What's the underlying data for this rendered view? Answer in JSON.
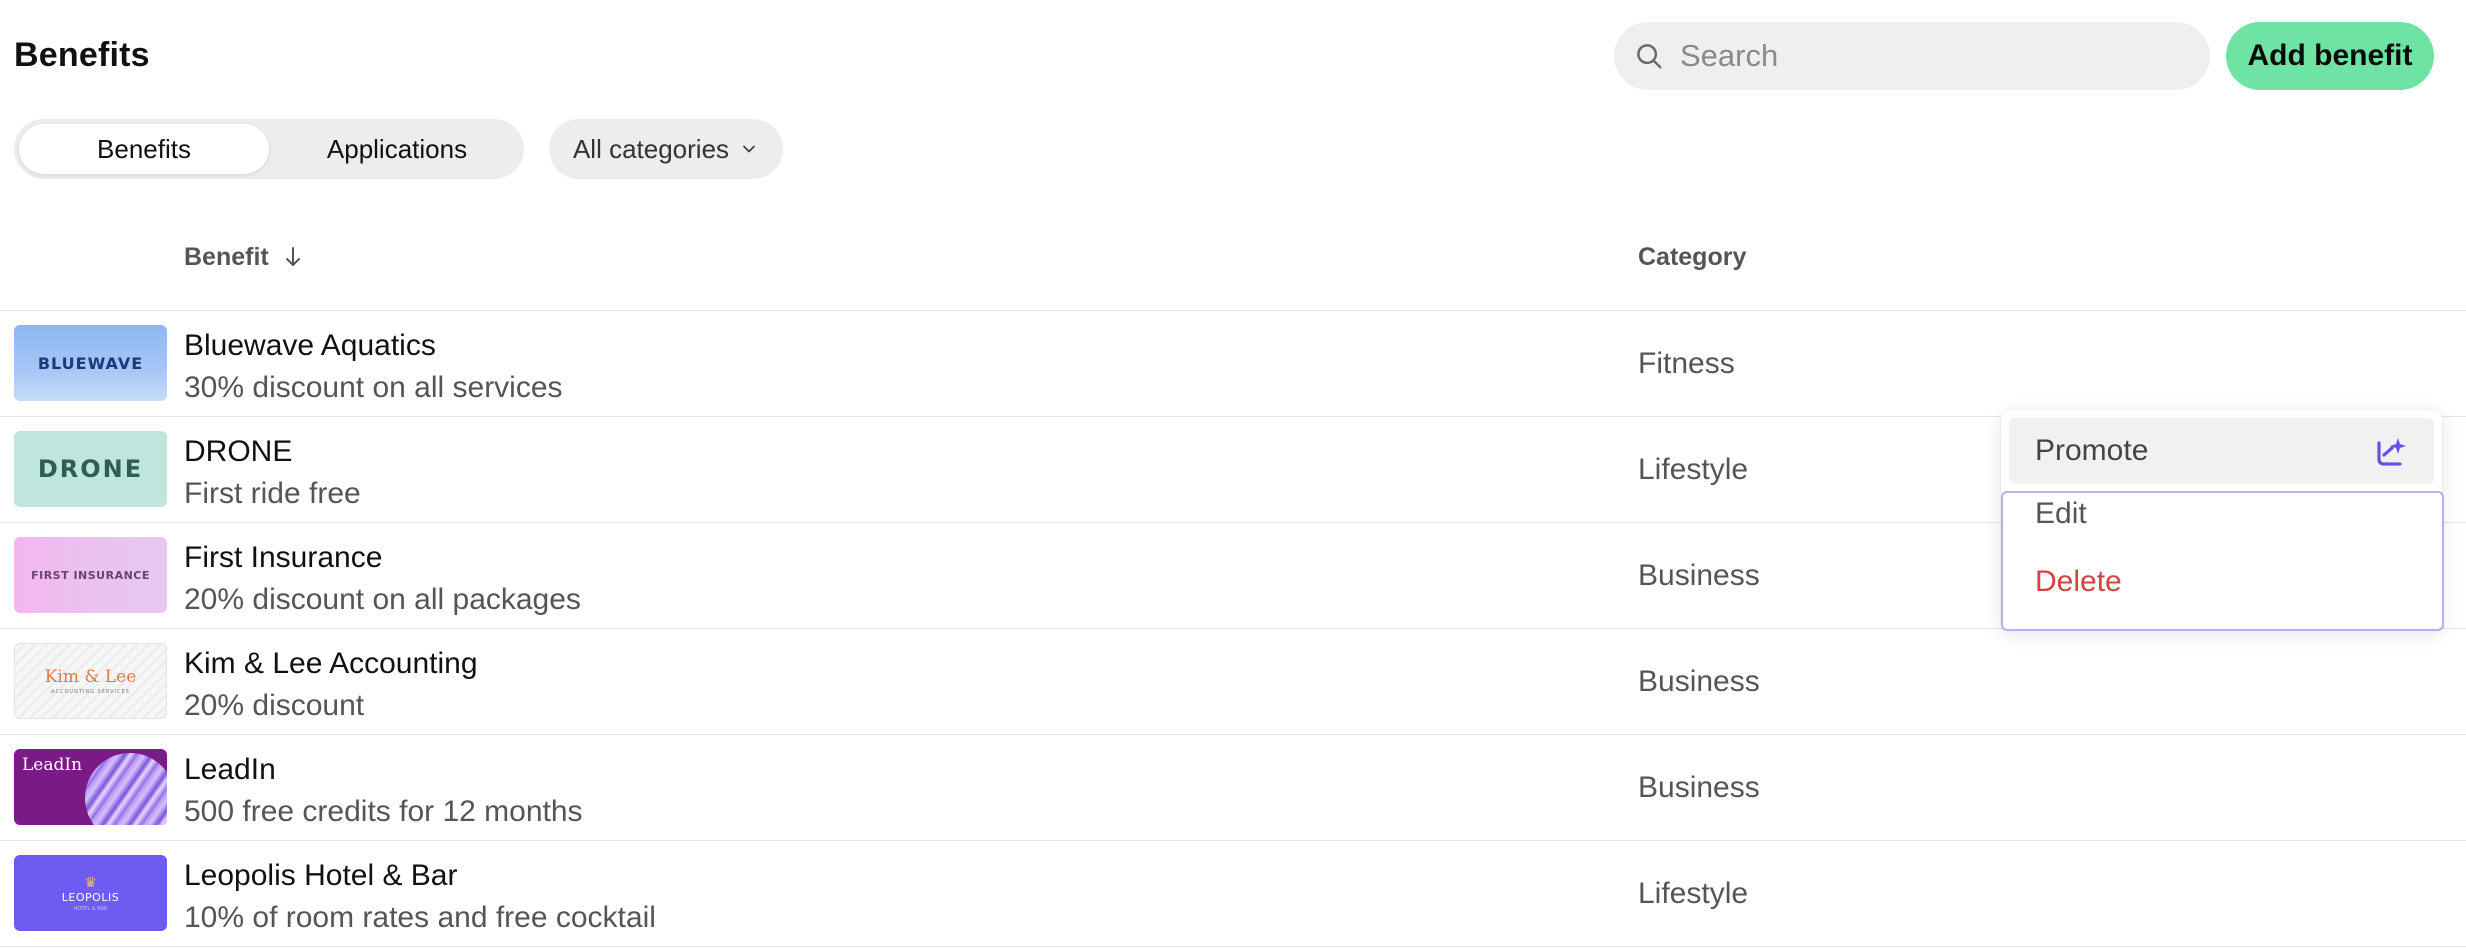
{
  "header": {
    "title": "Benefits",
    "search_placeholder": "Search",
    "add_button_label": "Add benefit"
  },
  "tabs": [
    {
      "label": "Benefits",
      "active": true
    },
    {
      "label": "Applications",
      "active": false
    }
  ],
  "filter": {
    "label": "All categories"
  },
  "table": {
    "columns": {
      "benefit": "Benefit",
      "category": "Category"
    },
    "rows": [
      {
        "name": "Bluewave Aquatics",
        "description": "30% discount on all services",
        "category": "Fitness",
        "logo_text": "BLUEWAVE"
      },
      {
        "name": "DRONE",
        "description": "First ride free",
        "category": "Lifestyle",
        "logo_text": "DRONE"
      },
      {
        "name": "First Insurance",
        "description": "20% discount on all packages",
        "category": "Business",
        "logo_text": "FIRST INSURANCE"
      },
      {
        "name": "Kim & Lee Accounting",
        "description": "20% discount",
        "category": "Business",
        "logo_text": "Kim & Lee",
        "logo_subtext": "ACCOUNTING SERVICES"
      },
      {
        "name": "LeadIn",
        "description": "500 free credits for 12 months",
        "category": "Business",
        "logo_text": "LeadIn"
      },
      {
        "name": "Leopolis Hotel & Bar",
        "description": "10% of room rates and free cocktail",
        "category": "Lifestyle",
        "logo_text": "LEOPOLIS",
        "logo_subtext": "HOTEL & BAR"
      }
    ]
  },
  "context_menu": {
    "promote_label": "Promote",
    "edit_label": "Edit",
    "delete_label": "Delete"
  },
  "colors": {
    "accent_green": "#6fe3a3",
    "delete_red": "#d2443f",
    "promote_purple": "#6b4fe0",
    "focus_outline": "#b7aef3"
  },
  "icons": {
    "search": "search-icon",
    "filter_chevron": "chevron-down-icon",
    "sort": "arrow-down-icon",
    "promote": "promote-sparkle-icon"
  }
}
